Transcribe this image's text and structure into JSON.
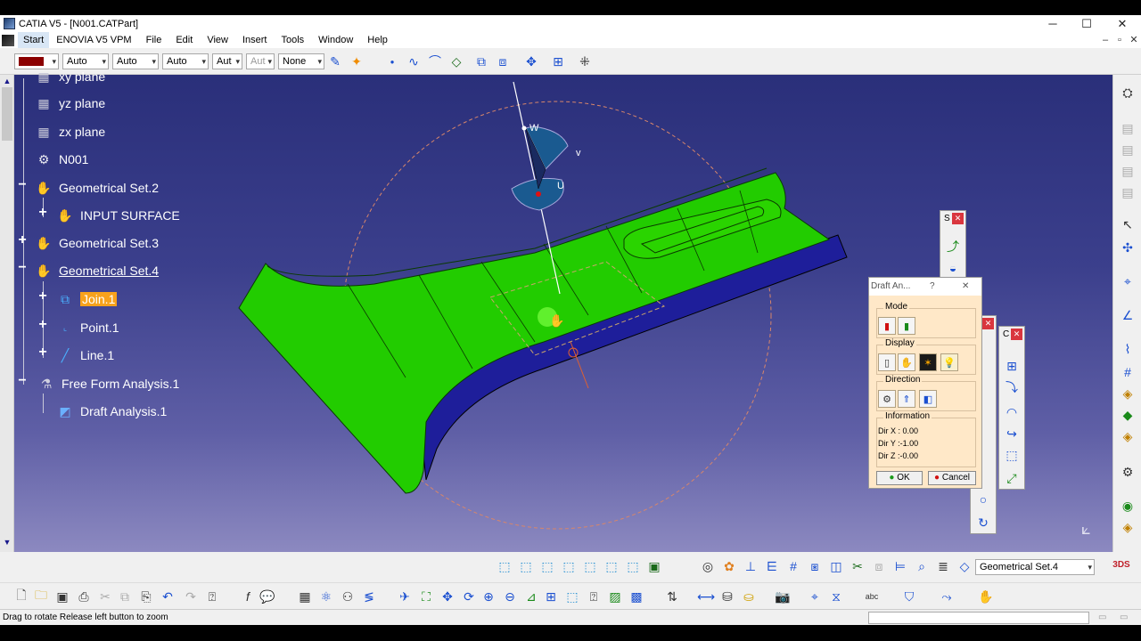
{
  "window": {
    "title": "CATIA V5 - [N001.CATPart]",
    "minimize": "─",
    "maximize": "☐",
    "close": "✕"
  },
  "menu": {
    "items": [
      "Start",
      "ENOVIA V5 VPM",
      "File",
      "Edit",
      "View",
      "Insert",
      "Tools",
      "Window",
      "Help"
    ]
  },
  "toolbar": {
    "color_combo": "",
    "linetype_combo": "Auto",
    "thickness_combo": "Auto",
    "point_combo": "Auto",
    "layer_combo_a": "Aut",
    "layer_combo_b": "Aut",
    "layer_combo_c": "None"
  },
  "tree": {
    "items": [
      {
        "label": "xy plane"
      },
      {
        "label": "yz plane"
      },
      {
        "label": "zx plane"
      },
      {
        "label": "N001"
      },
      {
        "label": "Geometrical Set.2"
      },
      {
        "label": "INPUT SURFACE"
      },
      {
        "label": "Geometrical Set.3"
      },
      {
        "label": "Geometrical Set.4"
      },
      {
        "label": "Join.1"
      },
      {
        "label": "Point.1"
      },
      {
        "label": "Line.1"
      },
      {
        "label": "Free Form Analysis.1"
      },
      {
        "label": "Draft Analysis.1"
      }
    ]
  },
  "compass": {
    "u": "U",
    "v": "v",
    "w": "W"
  },
  "dialog": {
    "title": "Draft An...",
    "help": "?",
    "close": "✕",
    "mode_label": "Mode",
    "display_label": "Display",
    "direction_label": "Direction",
    "information_label": "Information",
    "dir_x": "Dir X :   0.00",
    "dir_y": "Dir Y :-1.00",
    "dir_z": "Dir Z :-0.00",
    "ok": "OK",
    "cancel": "Cancel"
  },
  "mini_panels": {
    "p1_title": "S",
    "p2_title": "C"
  },
  "bottom": {
    "current_set": "Geometrical Set.4",
    "status": "Drag to rotate  Release left button to zoom"
  },
  "colors": {
    "accent_highlight": "#f7a21c",
    "surface_green": "#22cc00",
    "flange_blue": "#1e1e9a"
  }
}
